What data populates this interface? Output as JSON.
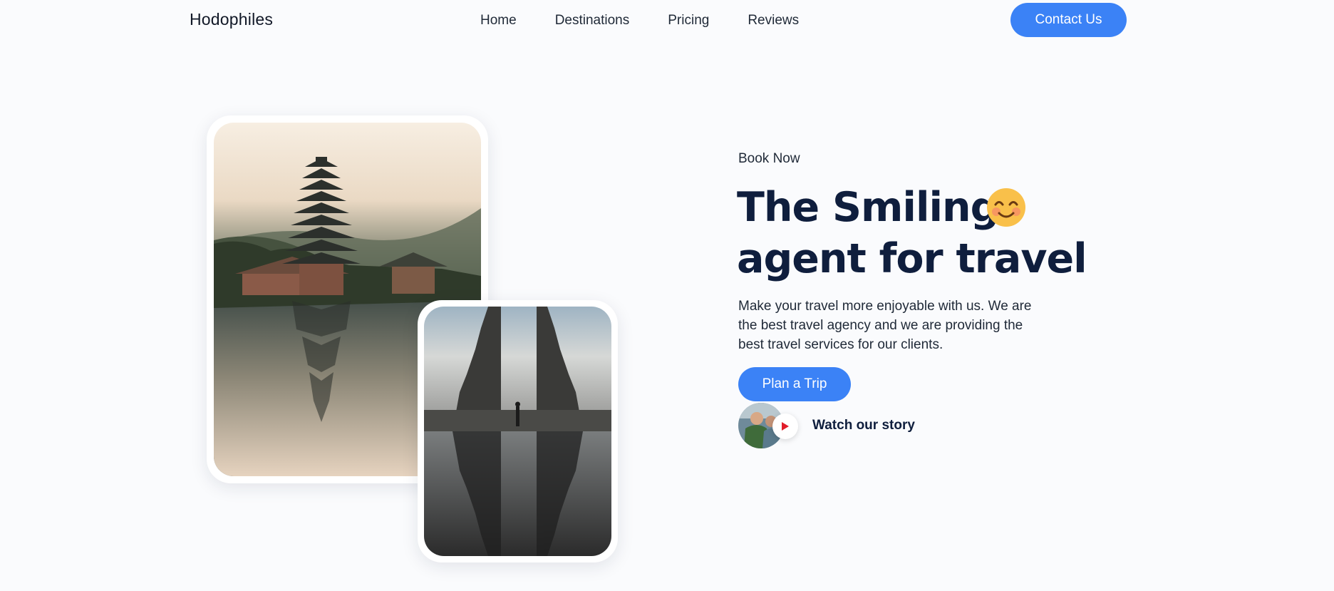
{
  "header": {
    "brand": "Hodophiles",
    "nav": [
      "Home",
      "Destinations",
      "Pricing",
      "Reviews"
    ],
    "contact_label": "Contact Us"
  },
  "hero": {
    "eyebrow": "Book Now",
    "title_line1": "The Smiling",
    "title_line2": "agent for travel",
    "emoji": "smiling-face-icon",
    "description": "Make your travel more enjoyable with us. We are the best travel agency and we are providing the best travel services for our clients.",
    "cta_label": "Plan a Trip",
    "story_label": "Watch our story"
  },
  "colors": {
    "accent": "#3b82f6",
    "heading": "#0f1e3d",
    "background": "#fafbfd"
  }
}
